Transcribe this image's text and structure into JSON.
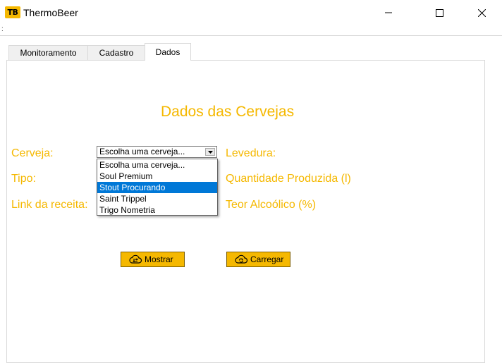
{
  "window": {
    "logo_text": "TB",
    "title": "ThermoBeer",
    "menu_dots": ":"
  },
  "tabs": [
    {
      "label": "Monitoramento",
      "selected": false
    },
    {
      "label": "Cadastro",
      "selected": false
    },
    {
      "label": "Dados",
      "selected": true
    }
  ],
  "main": {
    "heading": "Dados das Cervejas",
    "labels": {
      "cerveja": "Cerveja:",
      "tipo": "Tipo:",
      "link": "Link da receita:",
      "levedura": "Levedura:",
      "quantidade": "Quantidade Produzida (l)",
      "teor": "Teor Alcoólico (%)"
    },
    "combo": {
      "value": "Escolha uma cerveja...",
      "options": [
        "Escolha uma cerveja...",
        "Soul Premium",
        "Stout Procurando",
        "Saint Trippel",
        "Trigo Nometria"
      ],
      "highlighted_index": 2
    },
    "buttons": {
      "mostrar": "Mostrar",
      "carregar": "Carregar"
    }
  },
  "colors": {
    "accent": "#f5b800",
    "selection": "#0078d7"
  },
  "icons": {
    "mostrar": "cloud-sync-icon",
    "carregar": "cloud-refresh-icon"
  }
}
